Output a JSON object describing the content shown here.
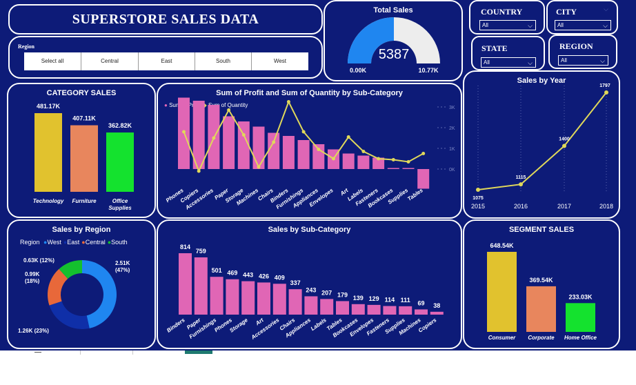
{
  "header": {
    "title": "SUPERSTORE SALES DATA"
  },
  "region_slicer": {
    "label": "Region",
    "options": [
      "Select all",
      "Central",
      "East",
      "South",
      "West"
    ]
  },
  "filters": {
    "country": {
      "label": "COUNTRY",
      "value": "All"
    },
    "city": {
      "label": "CITY",
      "value": "All"
    },
    "state": {
      "label": "STATE",
      "value": "All"
    },
    "region": {
      "label": "REGION",
      "value": "All"
    }
  },
  "gauge": {
    "title": "Total Sales",
    "value_label": "5387",
    "min_label": "0.00K",
    "max_label": "10.77K",
    "fill_fraction": 0.5
  },
  "category_sales": {
    "title": "CATEGORY SALES"
  },
  "profit_qty": {
    "title": "Sum of Profit and Sum of Quantity by Sub-Category",
    "legend_profit": "Sum of Profit",
    "legend_qty": "Sum of Quantity"
  },
  "sales_by_year": {
    "title": "Sales by Year"
  },
  "sales_by_region": {
    "title": "Sales by Region",
    "legend_label": "Region"
  },
  "sales_by_subcat": {
    "title": "Sales by Sub-Category"
  },
  "segment_sales": {
    "title": "SEGMENT SALES"
  },
  "colors": {
    "background": "#0d1b78",
    "yellow": "#e1c22e",
    "orange": "#e8865d",
    "green": "#14e22e",
    "pink": "#e066b5",
    "line": "#e0d85a",
    "blue": "#1f86f0",
    "darkblue": "#0f2fa8"
  },
  "chart_data": [
    {
      "id": "category",
      "type": "bar",
      "categories": [
        "Technology",
        "Furniture",
        "Office Supplies"
      ],
      "values": [
        481.17,
        407.11,
        362.82
      ],
      "labels": [
        "481.17K",
        "407.11K",
        "362.82K"
      ],
      "colors": [
        "#e1c22e",
        "#e8865d",
        "#14e22e"
      ]
    },
    {
      "id": "profit_qty",
      "type": "bar",
      "categories": [
        "Phones",
        "Copiers",
        "Accessories",
        "Paper",
        "Storage",
        "Machines",
        "Chairs",
        "Binders",
        "Furnishings",
        "Appliances",
        "Envelopes",
        "Art",
        "Labels",
        "Fasteners",
        "Bookcases",
        "Supplies",
        "Tables"
      ],
      "y_ticks": [
        "3K",
        "2K",
        "1K",
        "0K"
      ],
      "series": [
        {
          "name": "Sum of Profit",
          "type": "bar",
          "values": [
            3.45,
            3.3,
            3.1,
            2.55,
            2.3,
            2.05,
            1.75,
            1.6,
            1.4,
            1.2,
            0.95,
            0.75,
            0.65,
            0.55,
            0.05,
            0.05,
            -0.95
          ]
        },
        {
          "name": "Sum of Quantity",
          "type": "line",
          "values": [
            1.8,
            -0.1,
            1.5,
            2.85,
            1.65,
            0.1,
            1.3,
            3.25,
            1.8,
            0.95,
            0.5,
            1.55,
            0.85,
            0.5,
            0.45,
            0.35,
            0.75
          ]
        }
      ]
    },
    {
      "id": "year",
      "type": "line",
      "x": [
        "2015",
        "2016",
        "2017",
        "2018"
      ],
      "values": [
        1075,
        1115,
        1400,
        1797
      ],
      "labels": [
        "1075",
        "1115",
        "1400",
        "1797"
      ]
    },
    {
      "id": "region",
      "type": "pie",
      "legend": [
        "West",
        "East",
        "Central",
        "South"
      ],
      "values": [
        2.51,
        1.26,
        0.99,
        0.63
      ],
      "labels": [
        "2.51K (47%)",
        "1.26K (23%)",
        "0.99K (18%)",
        "0.63K (12%)"
      ],
      "colors": [
        "#1f86f0",
        "#0f2fa8",
        "#e8683a",
        "#14c02e"
      ]
    },
    {
      "id": "subcat",
      "type": "bar",
      "categories": [
        "Binders",
        "Paper",
        "Furnishings",
        "Phones",
        "Storage",
        "Art",
        "Accessories",
        "Chairs",
        "Appliances",
        "Labels",
        "Tables",
        "Bookcases",
        "Envelopes",
        "Fasteners",
        "Supplies",
        "Machines",
        "Copiers"
      ],
      "values": [
        814,
        759,
        501,
        469,
        443,
        426,
        409,
        337,
        243,
        207,
        179,
        139,
        129,
        114,
        111,
        69,
        38
      ]
    },
    {
      "id": "segment",
      "type": "bar",
      "categories": [
        "Consumer",
        "Corporate",
        "Home Office"
      ],
      "values": [
        648.54,
        369.54,
        233.03
      ],
      "labels": [
        "648.54K",
        "369.54K",
        "233.03K"
      ],
      "colors": [
        "#e1c22e",
        "#e8865d",
        "#14e22e"
      ]
    }
  ]
}
